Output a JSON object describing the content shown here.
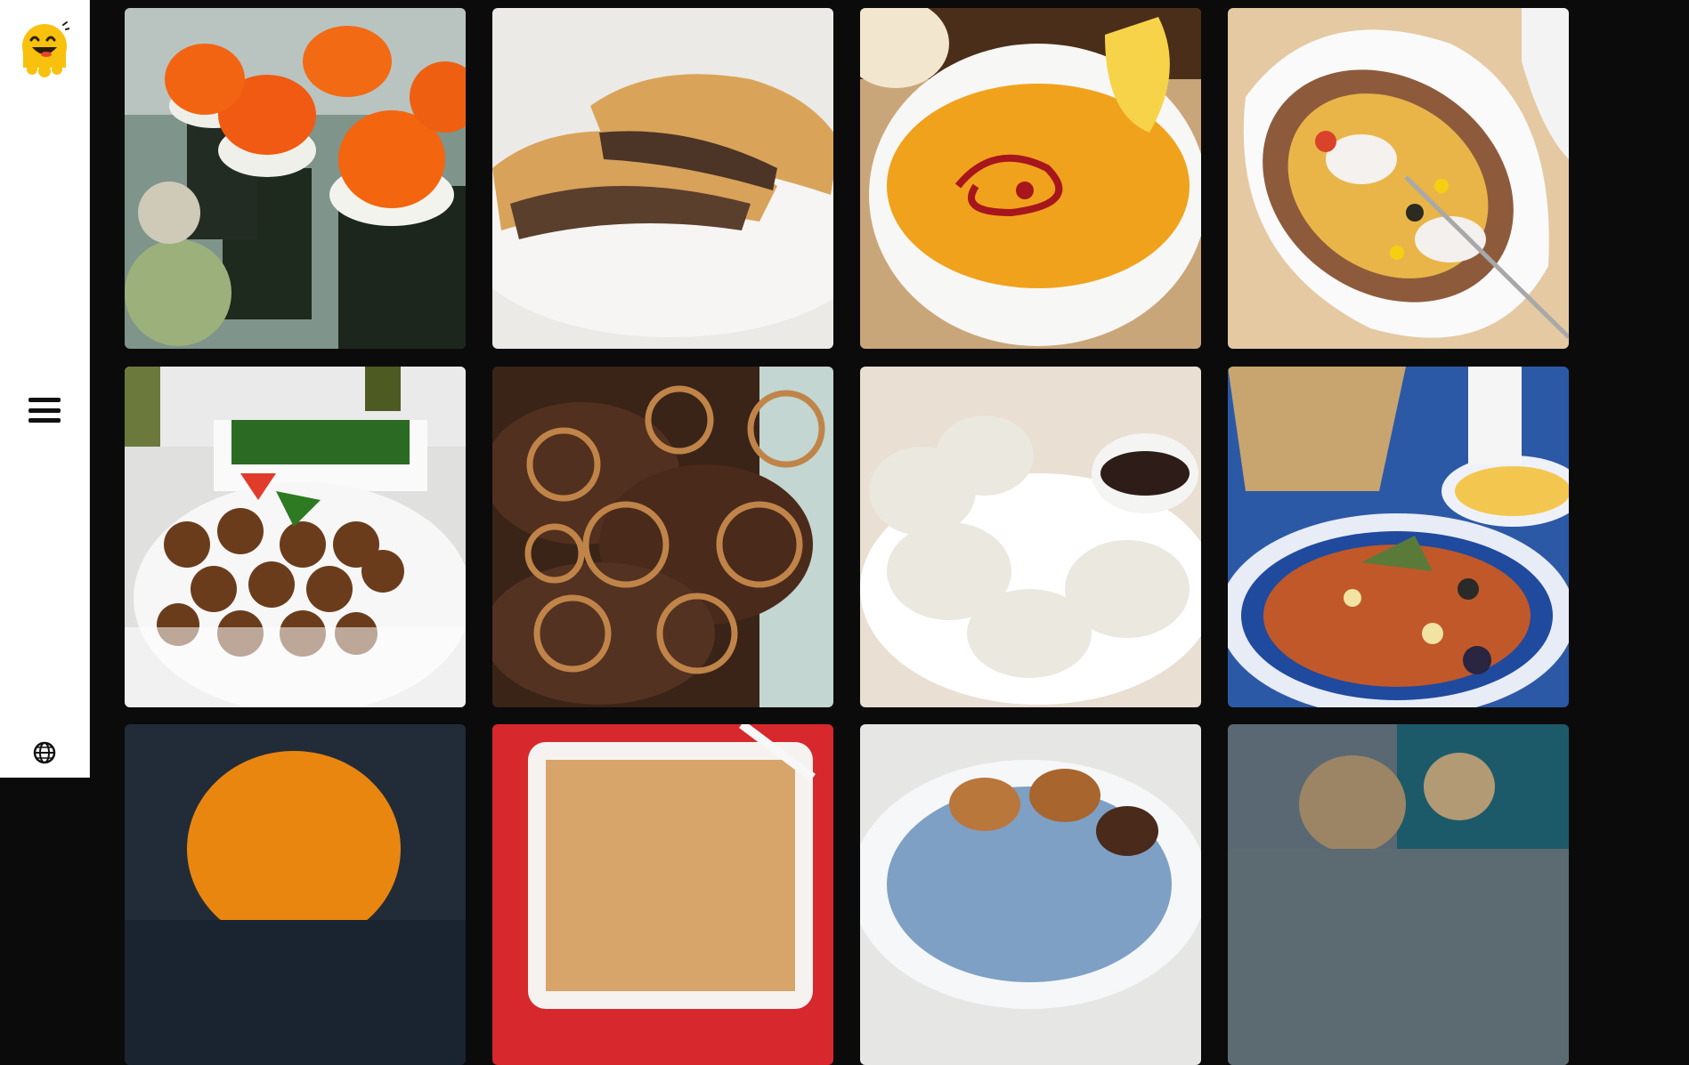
{
  "sidebar": {
    "logo_icon": "happy-face-logo",
    "menu_icon": "hamburger-icon",
    "language_icon": "globe-icon"
  },
  "gallery": {
    "tiles": [
      {
        "dish_icon": "sushi-roll-photo",
        "bg": "#5a7a6a"
      },
      {
        "dish_icon": "meat-pie-photo",
        "bg": "#efeeed"
      },
      {
        "dish_icon": "lentil-soup-photo",
        "bg": "#c69a5a"
      },
      {
        "dish_icon": "stuffed-potato-photo",
        "bg": "#e3c9a5"
      },
      {
        "dish_icon": "falafel-plate-photo",
        "bg": "#dcdcdc"
      },
      {
        "dish_icon": "liver-onions-photo",
        "bg": "#4a2c1e"
      },
      {
        "dish_icon": "dumplings-photo",
        "bg": "#ece6de"
      },
      {
        "dish_icon": "vegetable-stew-photo",
        "bg": "#2f5caa"
      },
      {
        "dish_icon": "orange-dish-photo",
        "bg": "#1b2632"
      },
      {
        "dish_icon": "red-casserole-photo",
        "bg": "#d92b30"
      },
      {
        "dish_icon": "fried-pastry-photo",
        "bg": "#e4e4e4"
      },
      {
        "dish_icon": "teapot-photo",
        "bg": "#5d6a72"
      }
    ]
  }
}
